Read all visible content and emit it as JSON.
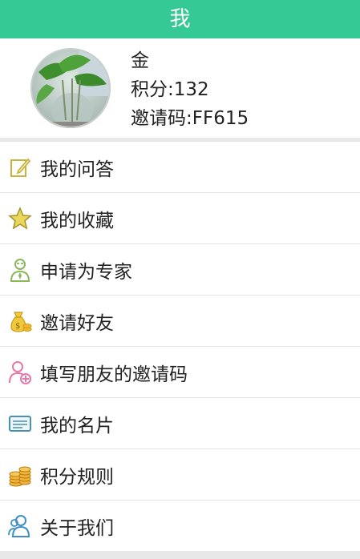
{
  "header": {
    "title": "我",
    "background": "#35c996"
  },
  "profile": {
    "name": "金",
    "points_label": "积分:",
    "points_value": "132",
    "invite_label": "邀请码:",
    "invite_value": "FF615"
  },
  "menu": {
    "items": [
      {
        "label": "我的问答",
        "icon": "edit-icon"
      },
      {
        "label": "我的收藏",
        "icon": "star-icon"
      },
      {
        "label": "申请为专家",
        "icon": "expert-icon"
      },
      {
        "label": "邀请好友",
        "icon": "money-bag-icon"
      },
      {
        "label": "填写朋友的邀请码",
        "icon": "add-user-icon"
      },
      {
        "label": "我的名片",
        "icon": "card-icon"
      },
      {
        "label": "积分规则",
        "icon": "coins-icon"
      },
      {
        "label": "关于我们",
        "icon": "users-icon"
      }
    ]
  }
}
